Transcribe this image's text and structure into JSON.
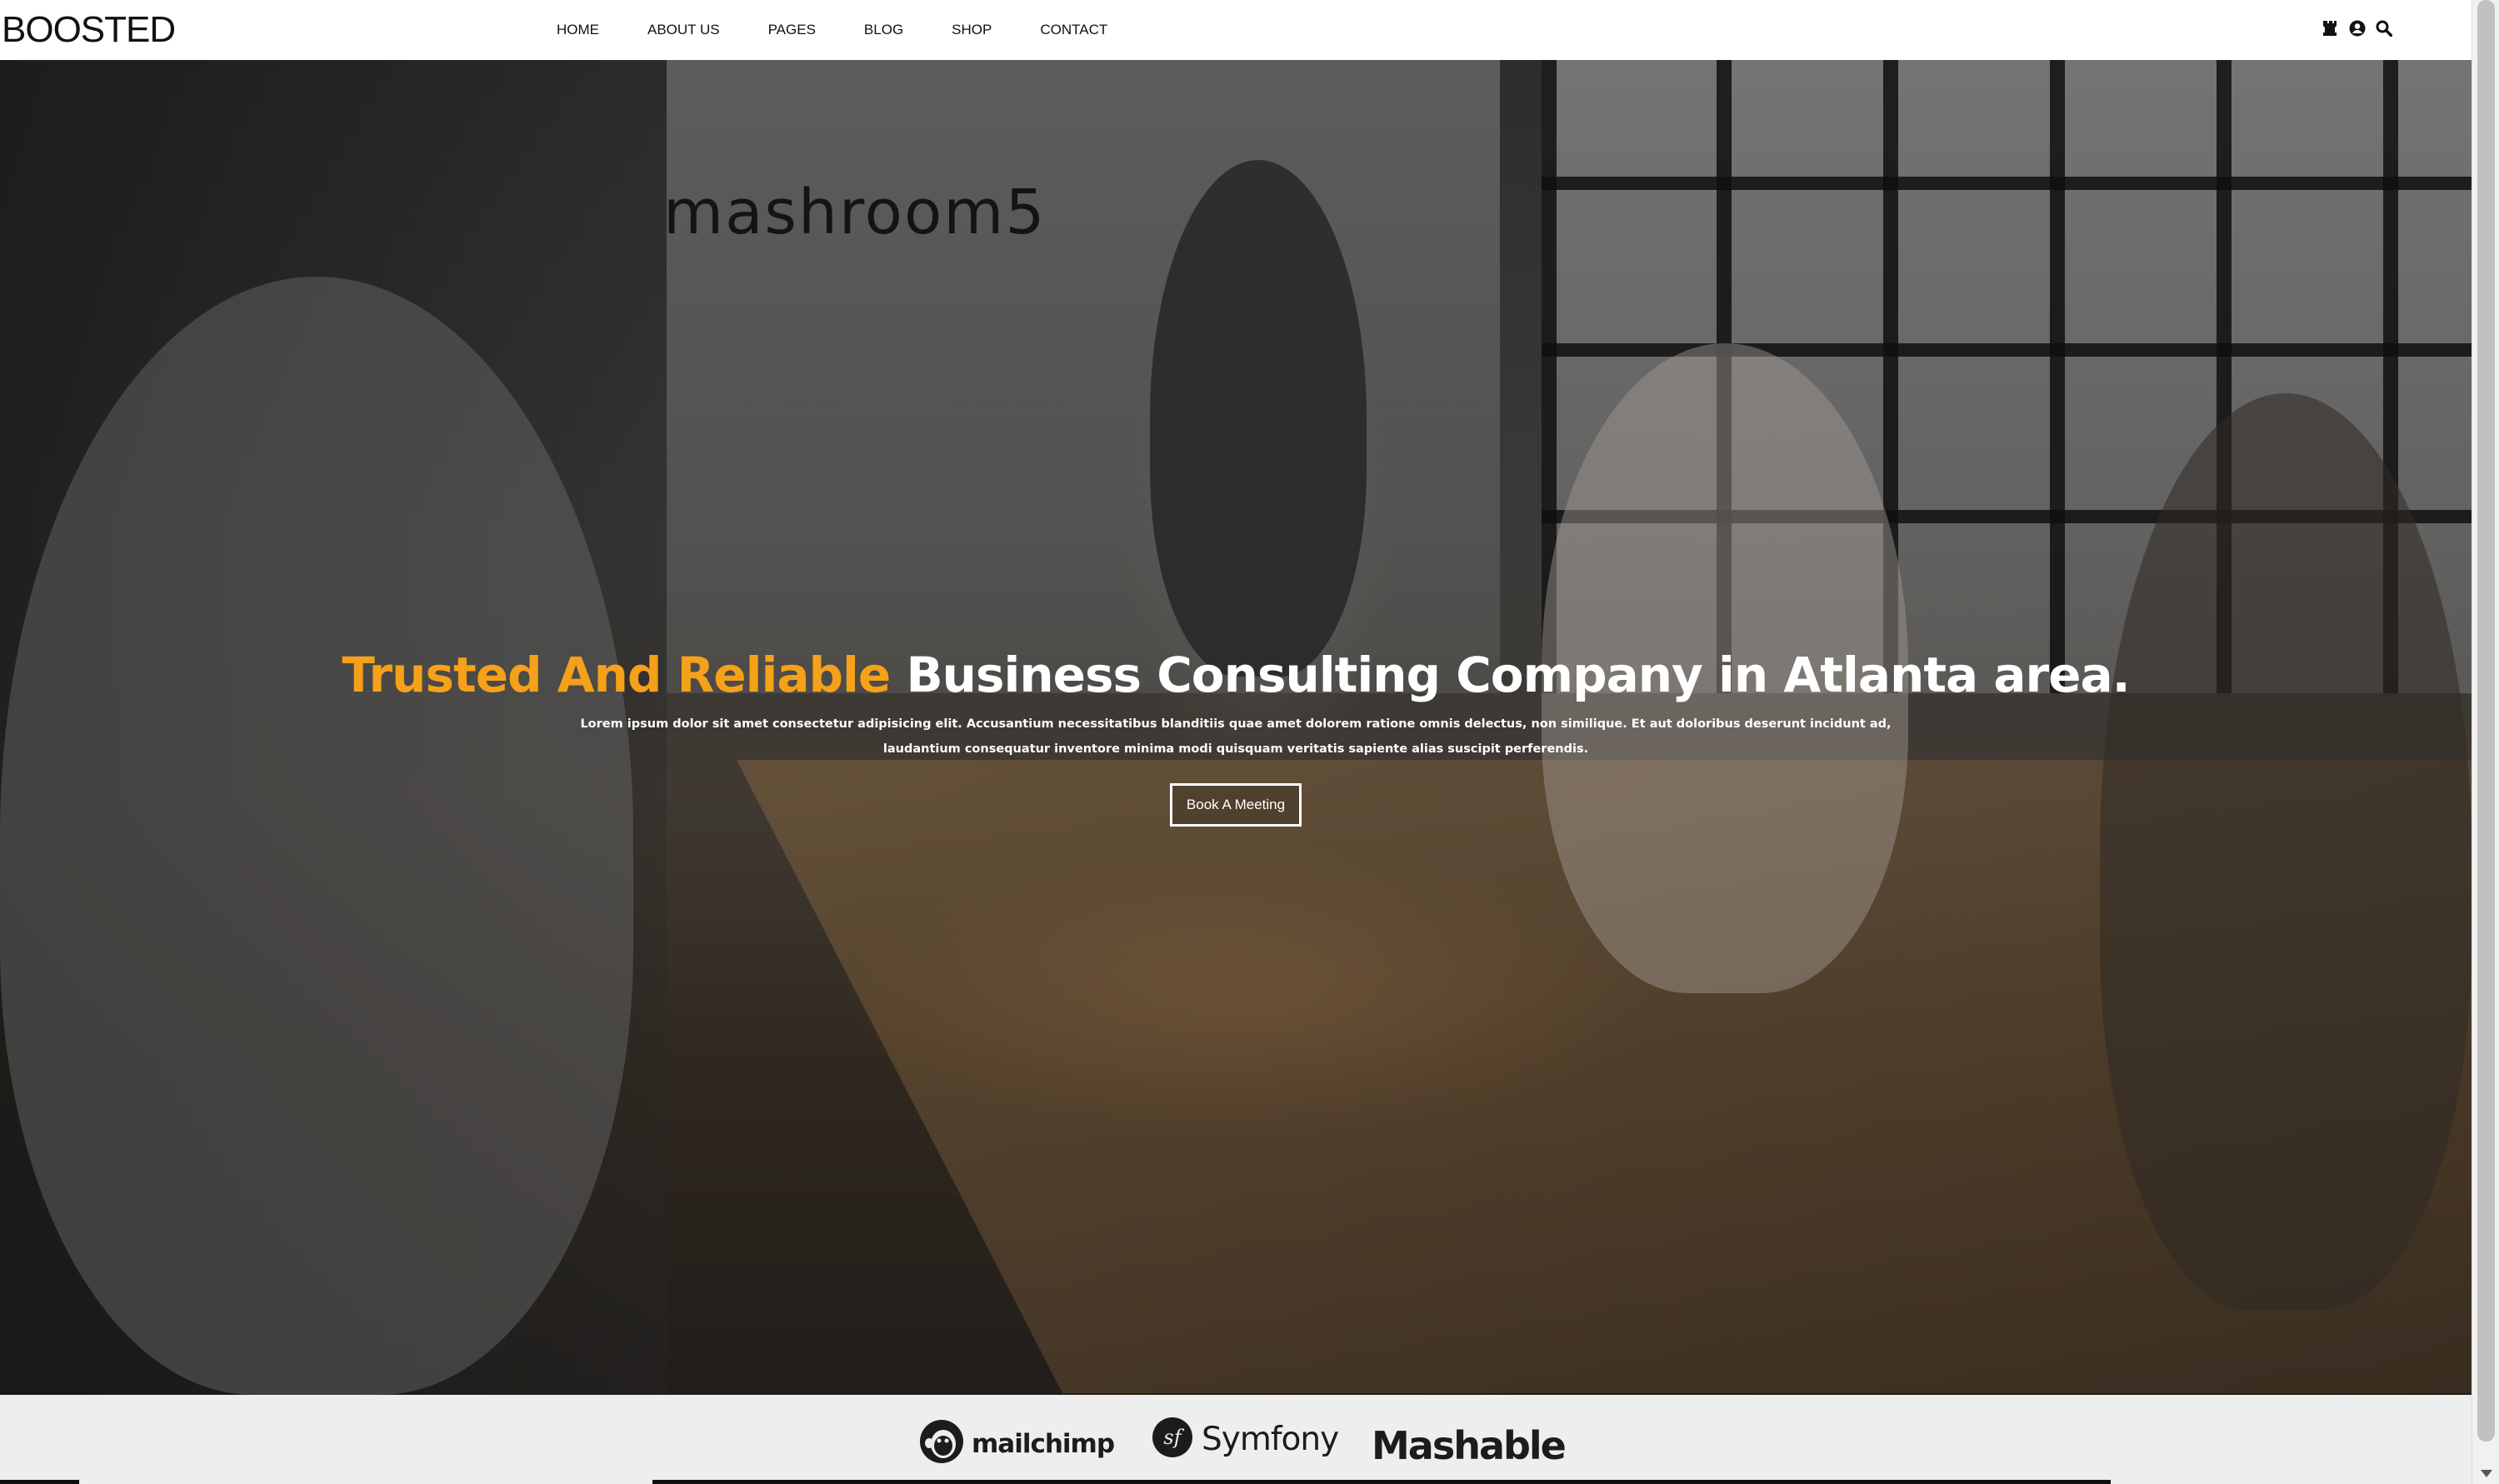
{
  "brand": {
    "logo_text": "BOOSTED"
  },
  "nav": {
    "items": [
      {
        "label": "HOME"
      },
      {
        "label": "ABOUT US"
      },
      {
        "label": "PAGES"
      },
      {
        "label": "BLOG"
      },
      {
        "label": "SHOP"
      },
      {
        "label": "CONTACT"
      }
    ],
    "icons": [
      "chess-rook-icon",
      "user-circle-icon",
      "search-icon"
    ]
  },
  "hero": {
    "title_accent": "Trusted And Reliable",
    "title_rest": "Business Consulting Company in Atlanta area.",
    "text": "Lorem ipsum dolor sit amet consectetur adipisicing elit. Accusantium necessitatibus blanditiis quae amet dolorem ratione omnis delectus, non similique. Et aut doloribus deserunt incidunt ad, laudantium consequatur inventore minima modi quisquam veritatis sapiente alias suscipit perferendis.",
    "button_label": "Book A Meeting",
    "photo_sign_text": "mashroom5"
  },
  "partners": {
    "items": [
      {
        "name": "mailchimp",
        "icon": "mailchimp-monkey-icon"
      },
      {
        "name": "Symfony",
        "icon": "symfony-sf-icon"
      },
      {
        "name": "Mashable",
        "icon": ""
      }
    ]
  },
  "colors": {
    "accent": "#f5a11a",
    "hero_text": "#ffffff",
    "nav_text": "#111111",
    "logos_bar_bg": "#eeeeee"
  }
}
